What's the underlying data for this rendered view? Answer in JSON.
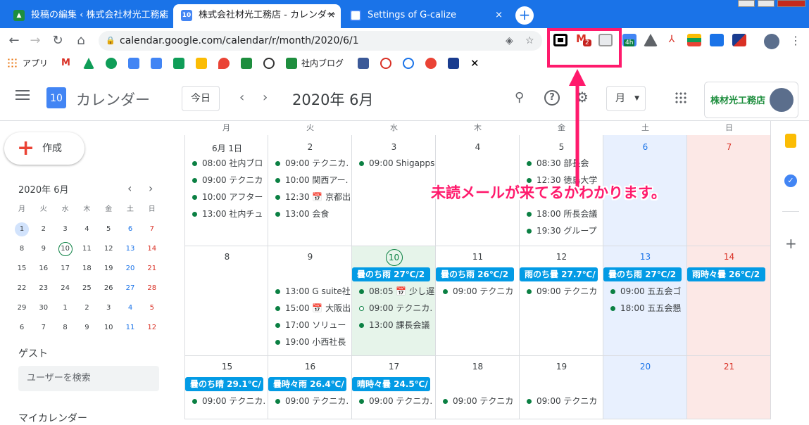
{
  "tabs": [
    {
      "label": "投稿の編集 ‹ 株式会社材光工務店",
      "favicon": "wordpress-icon",
      "color": "#1e8e3e"
    },
    {
      "label": "株式会社材光工務店 - カレンダー",
      "favicon": "calendar-icon",
      "color": "#4285f4",
      "fav_text": "10"
    },
    {
      "label": "Settings of G-calize",
      "favicon": "gcalize-icon",
      "color": "#4285f4"
    }
  ],
  "tab_close": "×",
  "new_tab": "+",
  "url": "calendar.google.com/calendar/r/month/2020/6/1",
  "bookmarks": {
    "apps_label": "アプリ",
    "blog_label": "社内ブログ"
  },
  "extensions": {
    "gmail_badge": "2",
    "timer_badge": "4h"
  },
  "header": {
    "app_title": "カレンダー",
    "logo_day": "10",
    "today_label": "今日",
    "month_title": "2020年 6月",
    "view_label": "月",
    "company_label": "株材光工務店"
  },
  "sidebar": {
    "create_label": "作成",
    "mini_title": "2020年 6月",
    "weekdays": [
      "月",
      "火",
      "水",
      "木",
      "金",
      "土",
      "日"
    ],
    "weeks": [
      [
        "1",
        "2",
        "3",
        "4",
        "5",
        "6",
        "7"
      ],
      [
        "8",
        "9",
        "10",
        "11",
        "12",
        "13",
        "14"
      ],
      [
        "15",
        "16",
        "17",
        "18",
        "19",
        "20",
        "21"
      ],
      [
        "22",
        "23",
        "24",
        "25",
        "26",
        "27",
        "28"
      ],
      [
        "29",
        "30",
        "1",
        "2",
        "3",
        "4",
        "5"
      ],
      [
        "6",
        "7",
        "8",
        "9",
        "10",
        "11",
        "12"
      ]
    ],
    "guest_title": "ゲスト",
    "search_placeholder": "ユーザーを検索",
    "my_calendars": "マイカレンダー"
  },
  "grid": {
    "weekdays": [
      "月",
      "火",
      "水",
      "木",
      "金",
      "土",
      "日"
    ],
    "weeks": [
      {
        "days": [
          {
            "num": "6月 1日",
            "events": [
              "08:00 社内ブロ",
              "09:00 テクニカ",
              "10:00 アフター",
              "13:00 社内チュ"
            ]
          },
          {
            "num": "2",
            "events": [
              "09:00 テクニカ.",
              "10:00 関西アー.",
              "12:30 📅 京都出",
              "13:00 会食"
            ]
          },
          {
            "num": "3",
            "events": [
              "09:00 Shigapps"
            ]
          },
          {
            "num": "4",
            "events": []
          },
          {
            "num": "5",
            "events": [
              "08:30 部長会",
              "12:30 徳島大学",
              "",
              "18:00 所長会議",
              "19:30 グループ"
            ]
          },
          {
            "num": "6",
            "events": []
          },
          {
            "num": "7",
            "events": []
          }
        ]
      },
      {
        "days": [
          {
            "num": "8",
            "events": []
          },
          {
            "num": "9",
            "events": [
              "13:00 G suite社",
              "15:00 📅 大阪出",
              "17:00 ソリュー",
              "19:00 小西社長"
            ]
          },
          {
            "num": "10",
            "weather": "曇のち雨 27℃/2",
            "events": [
              "08:05 📅 少し遅",
              "09:00 テクニカ.",
              "13:00 課長会議"
            ]
          },
          {
            "num": "11",
            "weather": "曇のち雨 26℃/2",
            "events": [
              "09:00 テクニカ"
            ]
          },
          {
            "num": "12",
            "weather": "雨のち曇 27.7℃/",
            "events": [
              "09:00 テクニカ"
            ]
          },
          {
            "num": "13",
            "weather": "曇のち雨 27℃/2",
            "events": [
              "09:00 五五会ゴ",
              "18:00 五五会懇"
            ]
          },
          {
            "num": "14",
            "weather": "雨時々曇 26℃/2",
            "events": []
          }
        ]
      },
      {
        "days": [
          {
            "num": "15",
            "weather": "曇のち晴 29.1℃/",
            "events": [
              "09:00 テクニカ."
            ]
          },
          {
            "num": "16",
            "weather": "曇時々雨 26.4℃/",
            "events": [
              "09:00 テクニカ."
            ]
          },
          {
            "num": "17",
            "weather": "晴時々曇 24.5℃/",
            "events": [
              "09:00 テクニカ."
            ]
          },
          {
            "num": "18",
            "events": [
              "09:00 テクニカ"
            ]
          },
          {
            "num": "19",
            "events": [
              "09:00 テクニカ"
            ]
          },
          {
            "num": "20",
            "events": []
          },
          {
            "num": "21",
            "events": []
          }
        ]
      }
    ]
  },
  "annotation": "未読メールが来てるかわかります。",
  "colors": {
    "brand_blue": "#1a73e8",
    "event_green": "#0b8043",
    "weather_blue": "#039be5",
    "highlight_pink": "#ff1a6c",
    "today_bg": "#e6f4ea",
    "sat_bg": "#e8f0fe",
    "sun_bg": "#fce8e6"
  }
}
